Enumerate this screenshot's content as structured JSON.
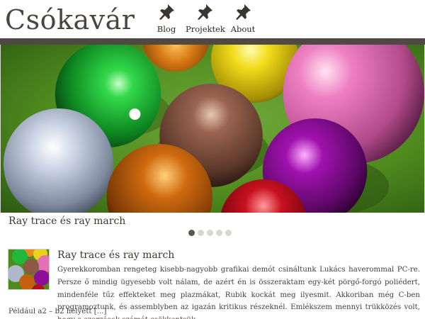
{
  "site": {
    "title": "Csókavár"
  },
  "nav": {
    "items": [
      {
        "label": "Blog",
        "icon": "pushpin-icon"
      },
      {
        "label": "Projektek",
        "icon": "pushpin-icon"
      },
      {
        "label": "About",
        "icon": "pushpin-icon"
      }
    ]
  },
  "slider": {
    "caption": "Ray trace és ray march",
    "dot_count": 5,
    "active_index": 0
  },
  "post": {
    "title": "Ray trace és ray march",
    "excerpt": "Gyerekkoromban rengeteg kisebb-nagyobb grafikai demót csináltunk Lukács haverommal PC-re. Persze ő mindig ügyesebb volt nálam, de azért én is összeraktam egy-két pörgő-forgó poliédert, mindenféle tűz effekteket meg plazmákat, Rubik kockát meg ilyesmit. Akkoriban még C-ben programoztunk, és assemblyben az igazán kritikus részeknél. Emlékszem mennyi trükközés volt, hogy a szorzások számát csökkentsük.",
    "excerpt_tail": "Például a2 – b2 helyett",
    "more": "[...]"
  },
  "colors": {
    "header_bar": "#4f4843",
    "title_text": "#4b4540",
    "table_green": "#4e8a1e",
    "dot_active": "#5d5550",
    "dot_inactive": "#dad6d2"
  }
}
